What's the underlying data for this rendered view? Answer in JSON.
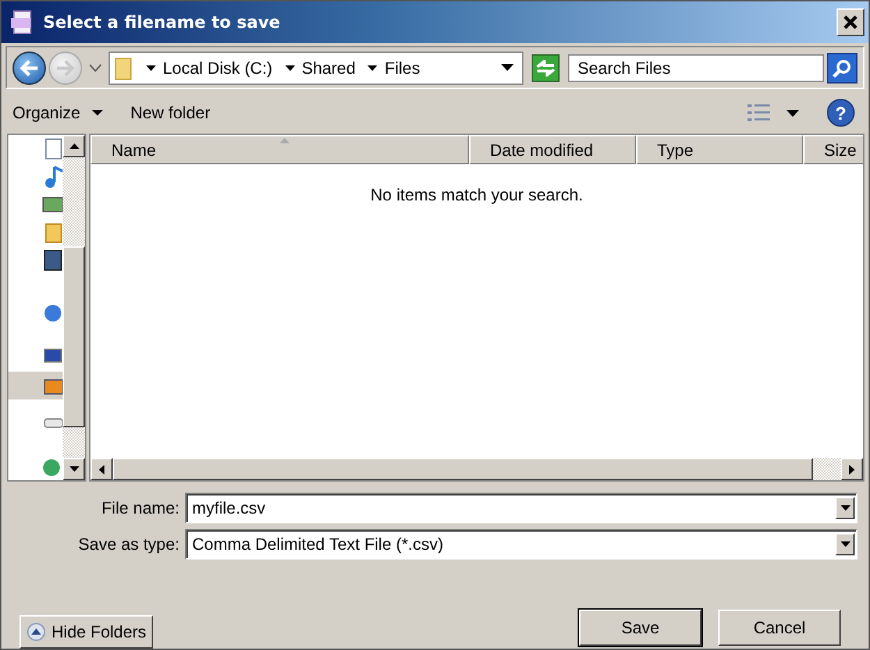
{
  "window": {
    "title": "Select a filename to save"
  },
  "address": {
    "crumbs": [
      "Local Disk (C:)",
      "Shared",
      "Files"
    ]
  },
  "search": {
    "placeholder": "Search Files"
  },
  "toolbar": {
    "organize": "Organize",
    "new_folder": "New folder",
    "help": "?"
  },
  "nav_items": [
    {
      "selected": false
    },
    {
      "selected": false
    },
    {
      "selected": false
    },
    {
      "selected": false
    },
    {
      "selected": false
    },
    {
      "selected": false
    },
    {
      "selected": false
    },
    {
      "selected": true
    },
    {
      "selected": false
    },
    {
      "selected": false
    }
  ],
  "table": {
    "columns": [
      {
        "label": "Name",
        "sorted": true
      },
      {
        "label": "Date modified",
        "sorted": false
      },
      {
        "label": "Type",
        "sorted": false
      },
      {
        "label": "Size",
        "sorted": false
      }
    ],
    "empty_message": "No items match your search."
  },
  "file_name": {
    "label": "File name:",
    "value": "myfile.csv"
  },
  "save_as_type": {
    "label": "Save as type:",
    "value": "Comma Delimited Text File (*.csv)"
  },
  "buttons": {
    "hide_folders": "Hide Folders",
    "save": "Save",
    "cancel": "Cancel"
  }
}
